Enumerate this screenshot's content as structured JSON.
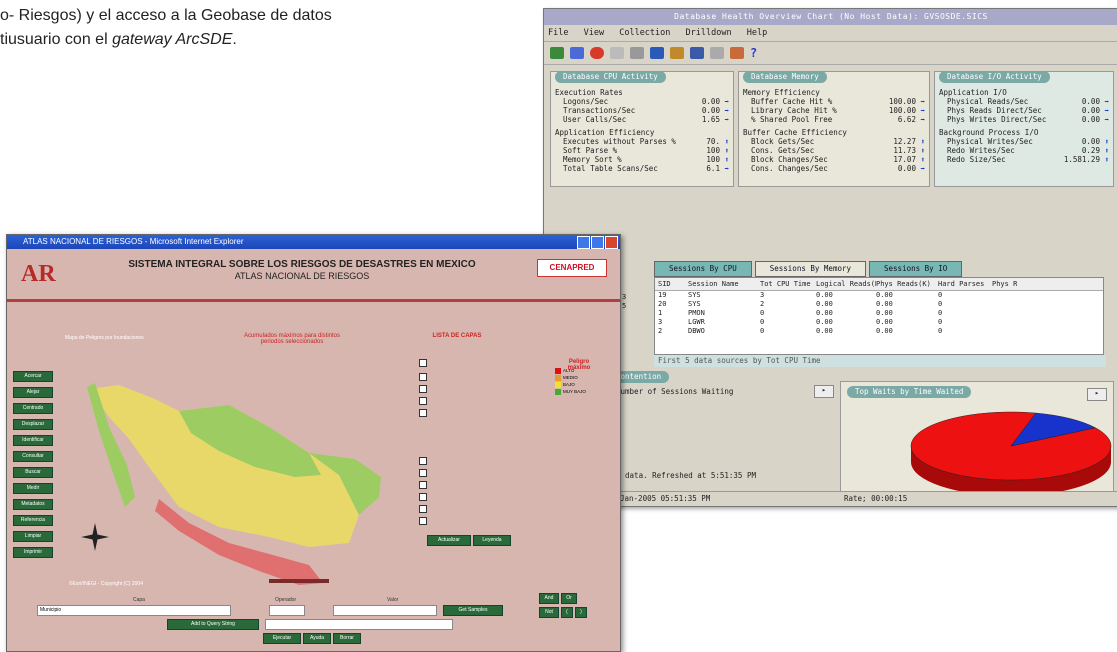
{
  "document": {
    "line1": "o- Riesgos) y el acceso a la Geobase de datos",
    "line2_prefix": "tiusuario con el ",
    "line2_em": "gateway ArcSDE",
    "line2_suffix": "."
  },
  "oracle": {
    "title": "Database Health Overview Chart (No Host Data): GVSOSDE.SICS",
    "menu": [
      "File",
      "View",
      "Collection",
      "Drilldown",
      "Help"
    ],
    "panels": {
      "cpu": {
        "title": "Database CPU Activity",
        "sections": [
          {
            "heading": "Execution Rates",
            "rows": [
              {
                "label": "Logons/Sec",
                "value": "0.00"
              },
              {
                "label": "Transactions/Sec",
                "value": "0.00"
              },
              {
                "label": "User Calls/Sec",
                "value": "1.65"
              }
            ]
          },
          {
            "heading": "Application Efficiency",
            "rows": [
              {
                "label": "Executes without Parses %",
                "value": "70."
              },
              {
                "label": "Soft Parse %",
                "value": "100"
              },
              {
                "label": "Memory Sort %",
                "value": "100"
              },
              {
                "label": "Total Table Scans/Sec",
                "value": "6.1"
              }
            ]
          }
        ]
      },
      "memory": {
        "title": "Database Memory",
        "sections": [
          {
            "heading": "Memory Efficiency",
            "rows": [
              {
                "label": "Buffer Cache Hit %",
                "value": "100.00"
              },
              {
                "label": "Library Cache Hit %",
                "value": "100.00"
              },
              {
                "label": "% Shared Pool Free",
                "value": "6.62"
              }
            ]
          },
          {
            "heading": "Buffer Cache Efficiency",
            "rows": [
              {
                "label": "Block Gets/Sec",
                "value": "12.27"
              },
              {
                "label": "Cons. Gets/Sec",
                "value": "11.73"
              },
              {
                "label": "Block Changes/Sec",
                "value": "17.07"
              },
              {
                "label": "Cons. Changes/Sec",
                "value": "0.00"
              }
            ]
          }
        ]
      },
      "io": {
        "title": "Database I/O Activity",
        "sections": [
          {
            "heading": "Application I/O",
            "rows": [
              {
                "label": "Physical Reads/Sec",
                "value": "0.00"
              },
              {
                "label": "Phys Reads Direct/Sec",
                "value": "0.00"
              },
              {
                "label": "Phys Writes Direct/Sec",
                "value": "0.00"
              }
            ]
          },
          {
            "heading": "Background Process I/O",
            "rows": [
              {
                "label": "Physical Writes/Sec",
                "value": "0.00"
              },
              {
                "label": "Redo Writes/Sec",
                "value": "0.29"
              },
              {
                "label": "Redo Size/Sec",
                "value": "1.581.29"
              }
            ]
          }
        ]
      }
    },
    "tabs": [
      "Sessions By CPU",
      "Sessions By Memory",
      "Sessions By IO"
    ],
    "grid_headers": [
      "SID",
      "Session Name",
      "Tot CPU Time",
      "Logical Reads(K)",
      "Phys Reads(K)",
      "Hard Parses",
      "Phys R"
    ],
    "grid_rows": [
      [
        "19",
        "SYS",
        "3",
        "0.00",
        "0.00",
        "0"
      ],
      [
        "20",
        "SYS",
        "2",
        "0.00",
        "0.00",
        "0"
      ],
      [
        "1",
        "PMON",
        "0",
        "0.00",
        "0.00",
        "0"
      ],
      [
        "3",
        "LGWR",
        "0",
        "0.00",
        "0.00",
        "0"
      ],
      [
        "2",
        "DBWO",
        "0",
        "0.00",
        "0.00",
        "0"
      ]
    ],
    "grid_hint": "First 5 data sources by Tot CPU Time",
    "left_side_numbers": [
      "3",
      "5"
    ],
    "contention_title": "Contention",
    "contention_label": "Number of Sessions Waiting",
    "pie_title": "Top Waits by Time Waited",
    "pie_slices": [
      {
        "name": "",
        "value": 88,
        "color": "#ee1111"
      },
      {
        "name": "",
        "value": 12,
        "color": "#1833cc"
      }
    ],
    "refresh_text": "o data. Refreshed at 5:51:35 PM",
    "status_date": "Jan-2005 05:51:35 PM",
    "status_rate": "Rate; 00:00:15"
  },
  "ie": {
    "title": "ATLAS NACIONAL DE RIESGOS - Microsoft Internet Explorer",
    "logo": "AR",
    "heading": "SISTEMA INTEGRAL SOBRE LOS RIESGOS DE DESASTRES EN MEXICO",
    "subheading": "ATLAS NACIONAL DE RIESGOS",
    "cenapred": "CENAPRED",
    "sidebar": [
      "Acercar",
      "Alejar",
      "Centrado",
      "Desplazar",
      "Identificar",
      "Consultar",
      "Buscar",
      "Medir",
      "Metadatos",
      "Referencia",
      "Limpiar",
      "Imprimir"
    ],
    "map_note": "Mapa de Peligros por Inundaciones",
    "accum_text": "Acumulados máximos para distintos periodos seleccionados",
    "layers_title": "LISTA DE CAPAS",
    "legend_title": "Peligro máximo",
    "legend": [
      {
        "label": "ALTO",
        "color": "#dd1111"
      },
      {
        "label": "MEDIO",
        "color": "#e89a2a"
      },
      {
        "label": "BAJO",
        "color": "#f0e030"
      },
      {
        "label": "MUY BAJO",
        "color": "#44aa33"
      }
    ],
    "actualizar": "Actualizar",
    "leyenda": "Leyenda",
    "copyright": "©Esri/INEGI - Copyright (C) 2004",
    "field_labels": [
      "Capa",
      "Operador",
      "Valor"
    ],
    "field_value": "Municipio",
    "query_btn": "Get Samples",
    "add_btn": "Add to Query String",
    "exec_btns": [
      "Ejecutar",
      "Ayuda",
      "Borrar"
    ],
    "corner_btns": [
      "And",
      "Or",
      "Not",
      "(",
      ")"
    ]
  }
}
